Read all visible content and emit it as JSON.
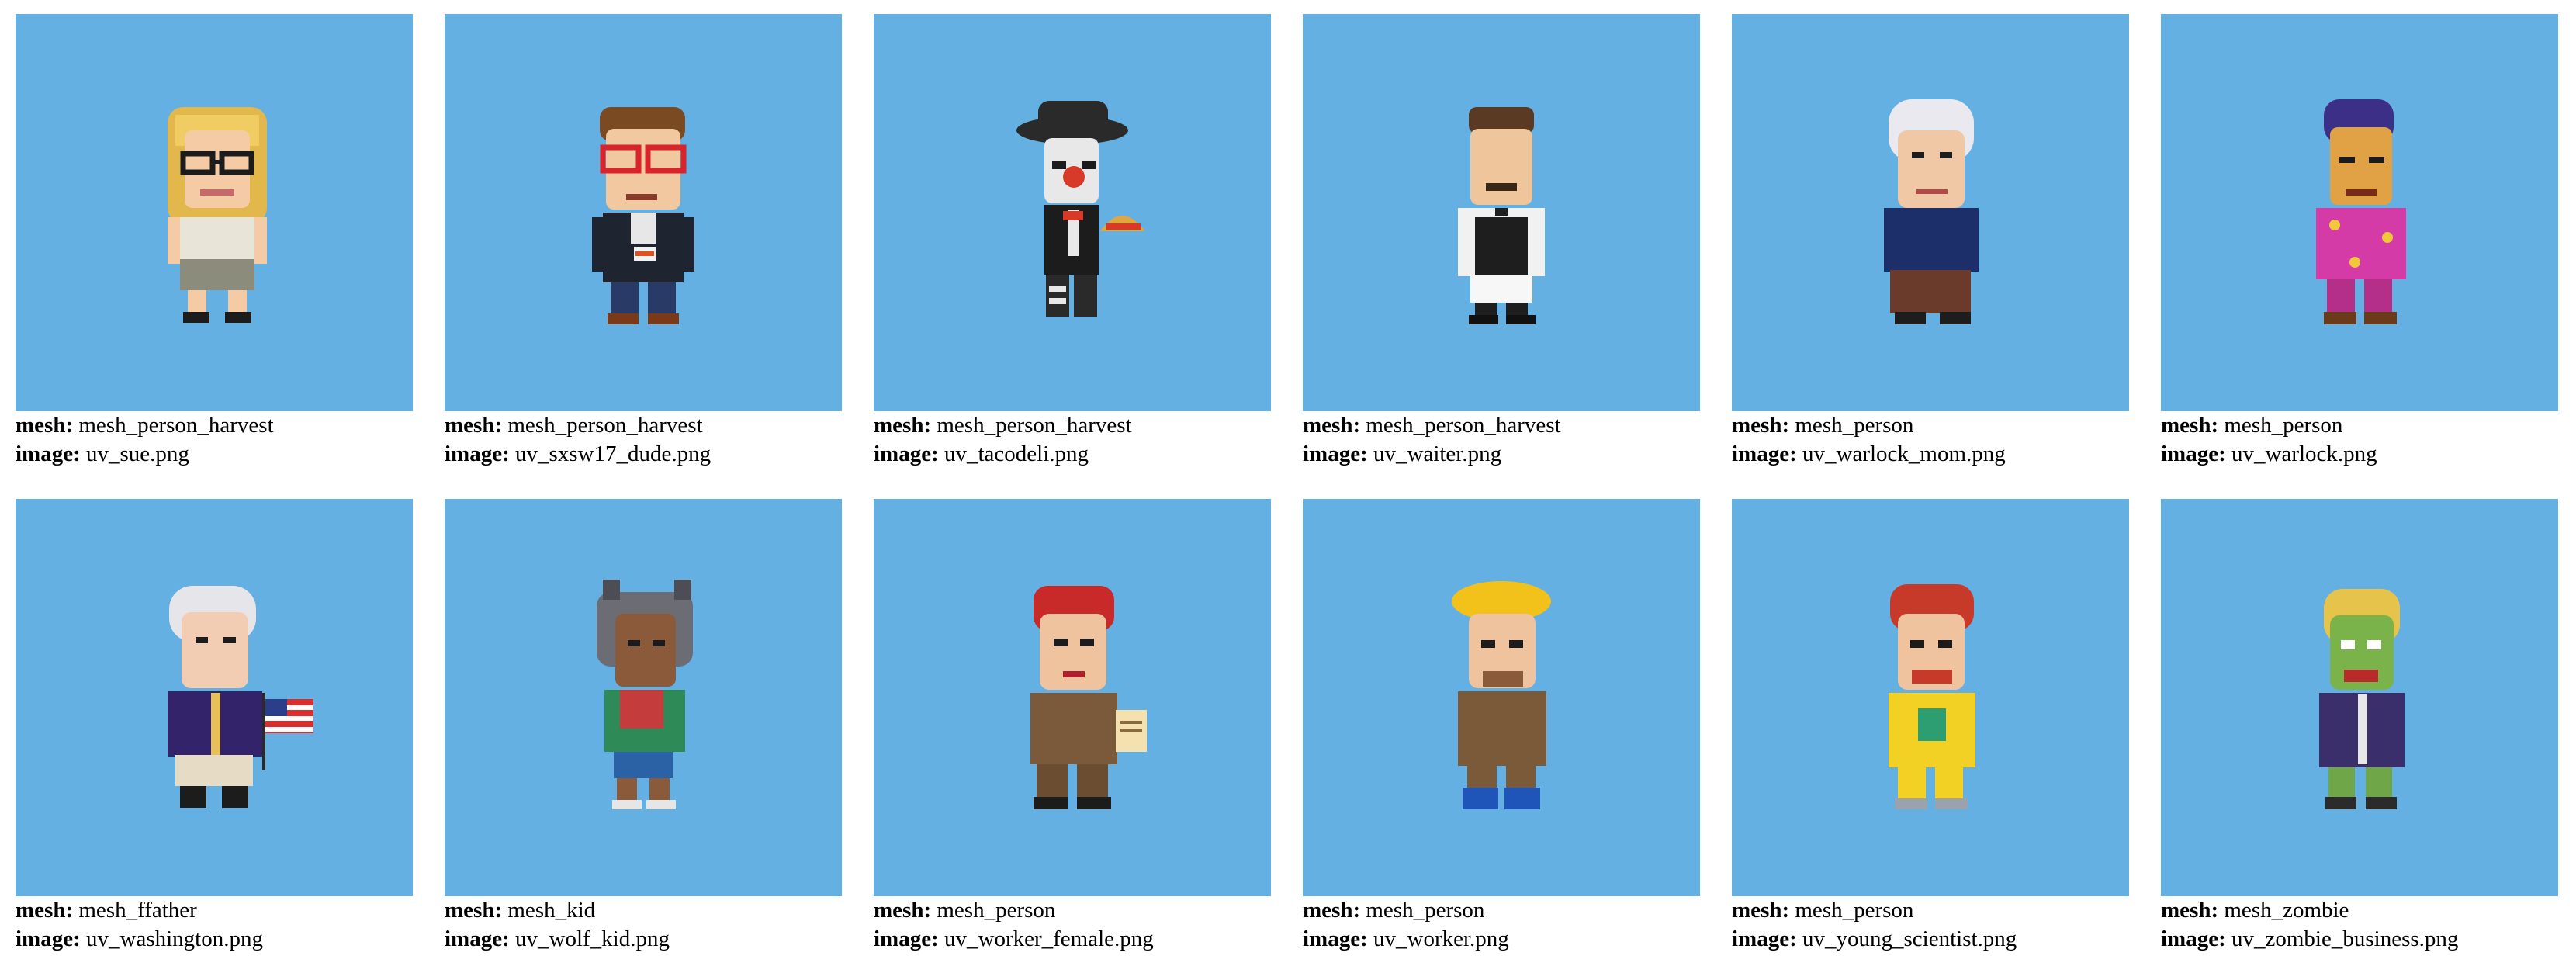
{
  "labels": {
    "mesh": "mesh:",
    "image": "image:"
  },
  "background_color": "#64b0e2",
  "items": [
    {
      "mesh": "mesh_person_harvest",
      "image": "uv_sue.png",
      "figure": "woman-glasses-blonde"
    },
    {
      "mesh": "mesh_person_harvest",
      "image": "uv_sxsw17_dude.png",
      "figure": "man-red-glasses-lanyard"
    },
    {
      "mesh": "mesh_person_harvest",
      "image": "uv_tacodeli.png",
      "figure": "sombrero-skeleton-with-taco"
    },
    {
      "mesh": "mesh_person_harvest",
      "image": "uv_waiter.png",
      "figure": "waiter-mustache"
    },
    {
      "mesh": "mesh_person",
      "image": "uv_warlock_mom.png",
      "figure": "old-woman-white-hair"
    },
    {
      "mesh": "mesh_person",
      "image": "uv_warlock.png",
      "figure": "warlock-purple-hair"
    },
    {
      "mesh": "mesh_ffather",
      "image": "uv_washington.png",
      "figure": "george-washington-flag"
    },
    {
      "mesh": "mesh_kid",
      "image": "uv_wolf_kid.png",
      "figure": "kid-wolf-hood"
    },
    {
      "mesh": "mesh_person",
      "image": "uv_worker_female.png",
      "figure": "female-worker-red-bandana"
    },
    {
      "mesh": "mesh_person",
      "image": "uv_worker.png",
      "figure": "construction-worker-hardhat"
    },
    {
      "mesh": "mesh_person",
      "image": "uv_young_scientist.png",
      "figure": "young-scientist-red-hair"
    },
    {
      "mesh": "mesh_zombie",
      "image": "uv_zombie_business.png",
      "figure": "zombie-business"
    }
  ]
}
